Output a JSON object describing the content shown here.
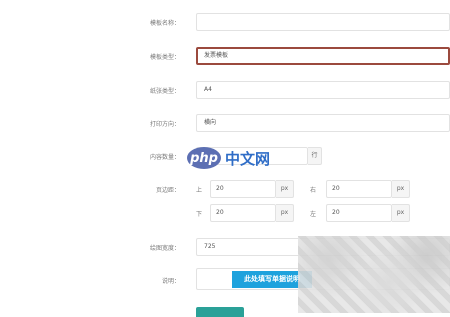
{
  "form": {
    "name": {
      "label": "模板名称：",
      "value": ""
    },
    "type": {
      "label": "模板类型：",
      "value": "发票模板"
    },
    "paper": {
      "label": "纸张类型：",
      "value": "A4"
    },
    "orientation": {
      "label": "打印方向：",
      "value": "横向"
    },
    "content_count": {
      "label": "内容数量：",
      "value": "",
      "unit": "行"
    },
    "margins": {
      "label": "页边距：",
      "top": {
        "label": "上",
        "value": "20",
        "unit": "px"
      },
      "right": {
        "label": "右",
        "value": "20",
        "unit": "px"
      },
      "bottom": {
        "label": "下",
        "value": "20",
        "unit": "px"
      },
      "left": {
        "label": "左",
        "value": "20",
        "unit": "px"
      }
    },
    "canvas_width": {
      "label": "绘图宽度：",
      "value": "725"
    },
    "note": {
      "label": "说明："
    }
  },
  "watermark": {
    "logo_badge": "php",
    "logo_text": "中文网",
    "banner": "此处填写单据说明"
  },
  "colors": {
    "focused_border": "#9b4a3e",
    "logo_badge": "#5c6fb3",
    "logo_text": "#2f6dc7",
    "banner": "#1ea2dd",
    "submit": "#2aa198"
  }
}
